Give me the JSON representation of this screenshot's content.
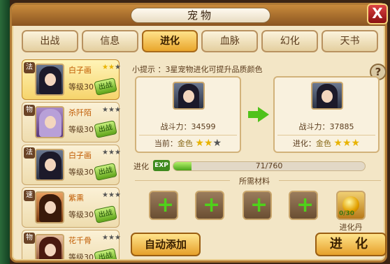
{
  "window": {
    "title": "宠物",
    "close_label": "X"
  },
  "tabs": [
    {
      "label": "出战",
      "active": false
    },
    {
      "label": "信息",
      "active": false
    },
    {
      "label": "进化",
      "active": true
    },
    {
      "label": "血脉",
      "active": false
    },
    {
      "label": "幻化",
      "active": false
    },
    {
      "label": "天书",
      "active": false
    }
  ],
  "pets": [
    {
      "type": "法",
      "name": "白子画",
      "stars": 2,
      "level": "等级30",
      "badge": "出战",
      "selected": true
    },
    {
      "type": "物",
      "name": "杀阡陌",
      "stars": 3,
      "level": "等级30",
      "badge": "出战",
      "selected": false
    },
    {
      "type": "法",
      "name": "白子画",
      "stars": 3,
      "level": "等级30",
      "badge": "出战",
      "selected": false
    },
    {
      "type": "速",
      "name": "紫熏",
      "stars": 3,
      "level": "等级30",
      "badge": "出战",
      "selected": false
    },
    {
      "type": "物",
      "name": "花千骨",
      "stars": 3,
      "level": "等级30",
      "badge": "出战",
      "selected": false
    }
  ],
  "hint": "小提示 ：3星宠物进化可提升品质颜色",
  "help_label": "?",
  "current": {
    "power": "战斗力：34599",
    "quality_prefix": "当前：",
    "quality": "金色",
    "stars": 2
  },
  "next": {
    "power": "战斗力：37885",
    "quality_prefix": "进化：",
    "quality": "金色",
    "stars": 3
  },
  "progress": {
    "label": "进化",
    "exp_badge": "EXP",
    "value": 71,
    "max": 760,
    "text": "71/760"
  },
  "materials": {
    "header": "所需材料",
    "slots": [
      "add-slot",
      "add-slot",
      "add-slot",
      "add-slot"
    ],
    "item_label": "进化丹",
    "item_count": "0/30"
  },
  "buttons": {
    "auto_add": "自动添加",
    "evolve": "进 化"
  },
  "colors": {
    "accent": "#e9a62c",
    "frame": "#b07a35",
    "success": "#4aa41a",
    "close": "#c02020"
  }
}
